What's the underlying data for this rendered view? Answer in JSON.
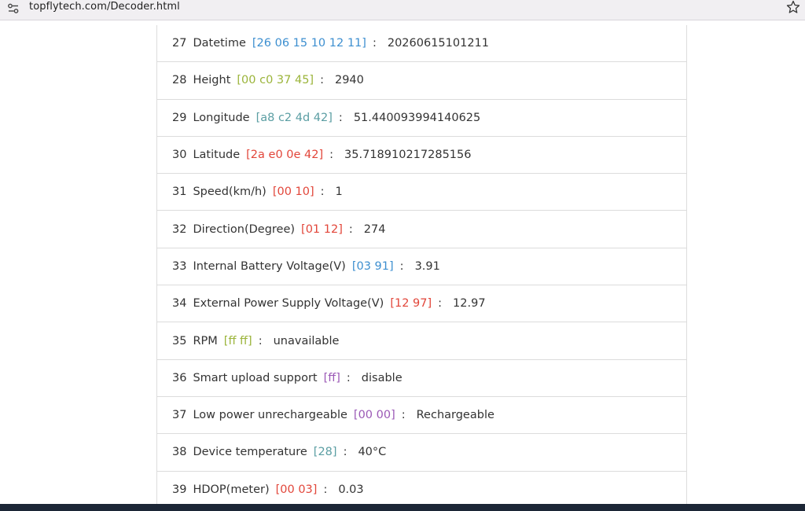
{
  "browser": {
    "url": "topflytech.com/Decoder.html"
  },
  "rows": [
    {
      "num": "27",
      "name": "Datetime",
      "hex": "[26 06 15 10 12 11]",
      "hex_color": "#3d8fd0",
      "sep": ":",
      "value": "20260615101211"
    },
    {
      "num": "28",
      "name": "Height",
      "hex": "[00 c0 37 45]",
      "hex_color": "#9bb43a",
      "sep": ":",
      "value": "2940"
    },
    {
      "num": "29",
      "name": "Longitude",
      "hex": "[a8 c2 4d 42]",
      "hex_color": "#5b9ea3",
      "sep": ":",
      "value": "51.440093994140625"
    },
    {
      "num": "30",
      "name": "Latitude",
      "hex": "[2a e0 0e 42]",
      "hex_color": "#e2463a",
      "sep": ":",
      "value": "35.718910217285156"
    },
    {
      "num": "31",
      "name": "Speed(km/h)",
      "hex": "[00 10]",
      "hex_color": "#e2463a",
      "sep": ":",
      "value": "1"
    },
    {
      "num": "32",
      "name": "Direction(Degree)",
      "hex": "[01 12]",
      "hex_color": "#e2463a",
      "sep": ":",
      "value": "274"
    },
    {
      "num": "33",
      "name": "Internal Battery Voltage(V)",
      "hex": "[03 91]",
      "hex_color": "#3d8fd0",
      "sep": ":",
      "value": "3.91"
    },
    {
      "num": "34",
      "name": "External Power Supply Voltage(V)",
      "hex": "[12 97]",
      "hex_color": "#e2463a",
      "sep": ":",
      "value": "12.97"
    },
    {
      "num": "35",
      "name": "RPM",
      "hex": "[ff ff]",
      "hex_color": "#9bb43a",
      "sep": ":",
      "value": "unavailable"
    },
    {
      "num": "36",
      "name": "Smart upload support",
      "hex": "[ff]",
      "hex_color": "#9b59b6",
      "sep": ":",
      "value": "disable"
    },
    {
      "num": "37",
      "name": "Low power unrechargeable",
      "hex": "[00 00]",
      "hex_color": "#9b59b6",
      "sep": ":",
      "value": "Rechargeable"
    },
    {
      "num": "38",
      "name": "Device temperature",
      "hex": "[28]",
      "hex_color": "#5b9ea3",
      "sep": ":",
      "value": "40°C"
    },
    {
      "num": "39",
      "name": "HDOP(meter)",
      "hex": "[00 03]",
      "hex_color": "#e2463a",
      "sep": ":",
      "value": "0.03"
    }
  ],
  "icons": {
    "site_info": "tune-icon",
    "bookmark": "star-outline-icon"
  }
}
